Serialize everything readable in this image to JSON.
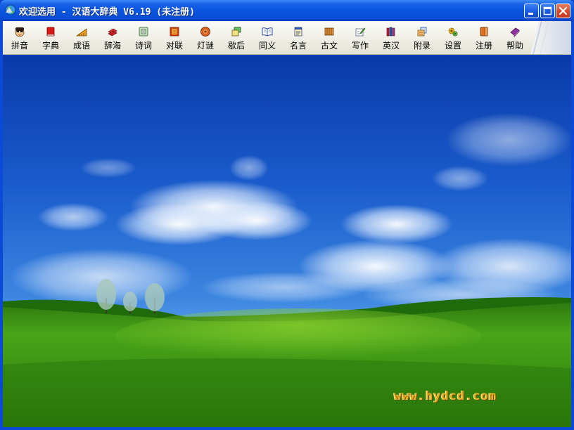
{
  "window": {
    "title": "欢迎选用 - 汉语大辞典 V6.19 (未注册)",
    "app_icon": "globe-icon",
    "controls": [
      {
        "name": "minimize-button",
        "icon": "minimize-icon"
      },
      {
        "name": "maximize-button",
        "icon": "maximize-icon"
      },
      {
        "name": "close-button",
        "icon": "close-icon"
      }
    ]
  },
  "toolbar": {
    "items": [
      {
        "label": "拼音",
        "icon": "face-avatar-icon"
      },
      {
        "label": "字典",
        "icon": "red-book-icon"
      },
      {
        "label": "成语",
        "icon": "ruler-icon"
      },
      {
        "label": "辞海",
        "icon": "books-icon"
      },
      {
        "label": "诗词",
        "icon": "scroll-icon"
      },
      {
        "label": "对联",
        "icon": "couplet-icon"
      },
      {
        "label": "灯谜",
        "icon": "lantern-icon"
      },
      {
        "label": "歇后",
        "icon": "cards-icon"
      },
      {
        "label": "同义",
        "icon": "open-book-icon"
      },
      {
        "label": "名言",
        "icon": "notepad-icon"
      },
      {
        "label": "古文",
        "icon": "bamboo-slips-icon"
      },
      {
        "label": "写作",
        "icon": "pen-paper-icon"
      },
      {
        "label": "英汉",
        "icon": "book-shelf-icon"
      },
      {
        "label": "附录",
        "icon": "document-stack-icon"
      },
      {
        "label": "设置",
        "icon": "gears-icon"
      },
      {
        "label": "注册",
        "icon": "register-book-icon"
      },
      {
        "label": "帮助",
        "icon": "help-book-icon"
      }
    ]
  },
  "content": {
    "background": "sky-and-grassland-wallpaper",
    "watermark": "www.hydcd.com"
  },
  "colors": {
    "titlebar": "#0a55e0",
    "toolbar": "#f0efe6",
    "sky_top": "#0a3fb0",
    "grass": "#3e9a12",
    "watermark": "#e8b020"
  }
}
